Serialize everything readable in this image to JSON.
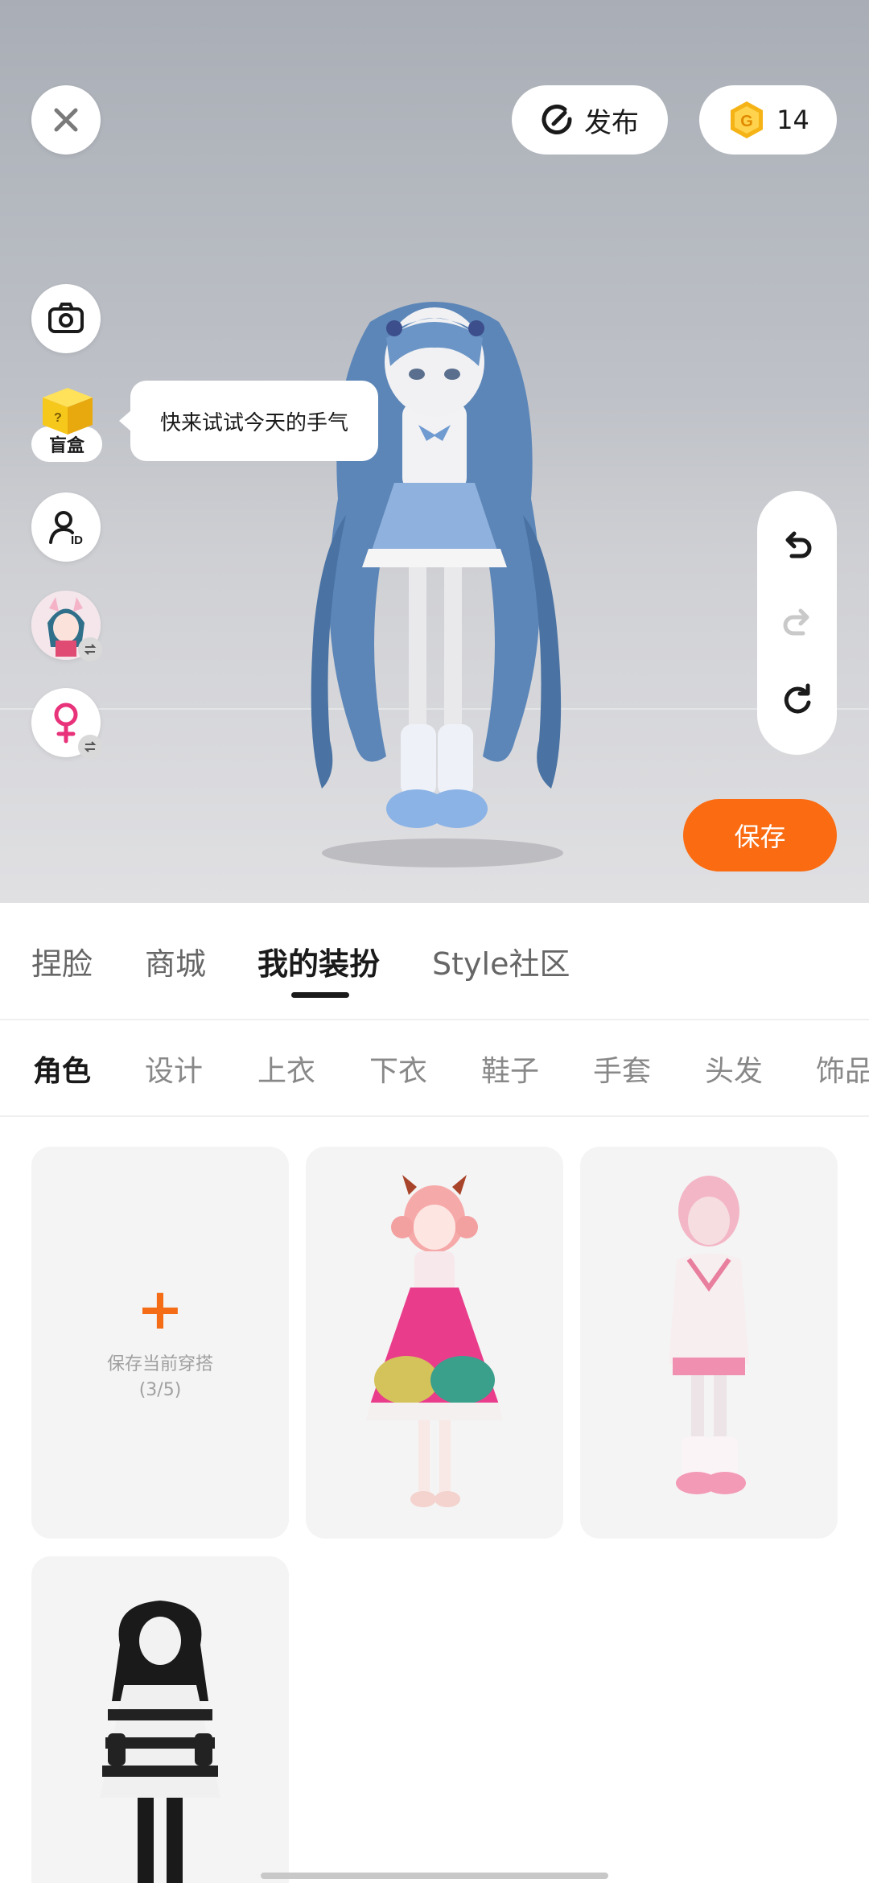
{
  "toolbar": {
    "publish_label": "发布",
    "coin_count": "14"
  },
  "left_tools": {
    "blindbox_label": "盲盒",
    "tooltip": "快来试试今天的手气"
  },
  "save_label": "保存",
  "main_tabs": [
    {
      "label": "捏脸",
      "active": false
    },
    {
      "label": "商城",
      "active": false
    },
    {
      "label": "我的装扮",
      "active": true
    },
    {
      "label": "Style社区",
      "active": false
    }
  ],
  "sub_tabs": [
    {
      "label": "角色",
      "active": true
    },
    {
      "label": "设计",
      "active": false
    },
    {
      "label": "上衣",
      "active": false
    },
    {
      "label": "下衣",
      "active": false
    },
    {
      "label": "鞋子",
      "active": false
    },
    {
      "label": "手套",
      "active": false
    },
    {
      "label": "头发",
      "active": false
    },
    {
      "label": "饰品",
      "active": false
    }
  ],
  "outfits": {
    "add_label": "保存当前穿搭",
    "add_count": "(3/5)"
  },
  "colors": {
    "accent": "#fa6b12",
    "coin": "#f5b316",
    "gender": "#e8327a"
  },
  "icons": [
    "close-icon",
    "publish-icon",
    "coin-icon",
    "camera-icon",
    "blindbox-icon",
    "avatar-id-icon",
    "swap-icon",
    "female-icon",
    "undo-icon",
    "redo-icon",
    "reset-icon",
    "plus-icon"
  ]
}
